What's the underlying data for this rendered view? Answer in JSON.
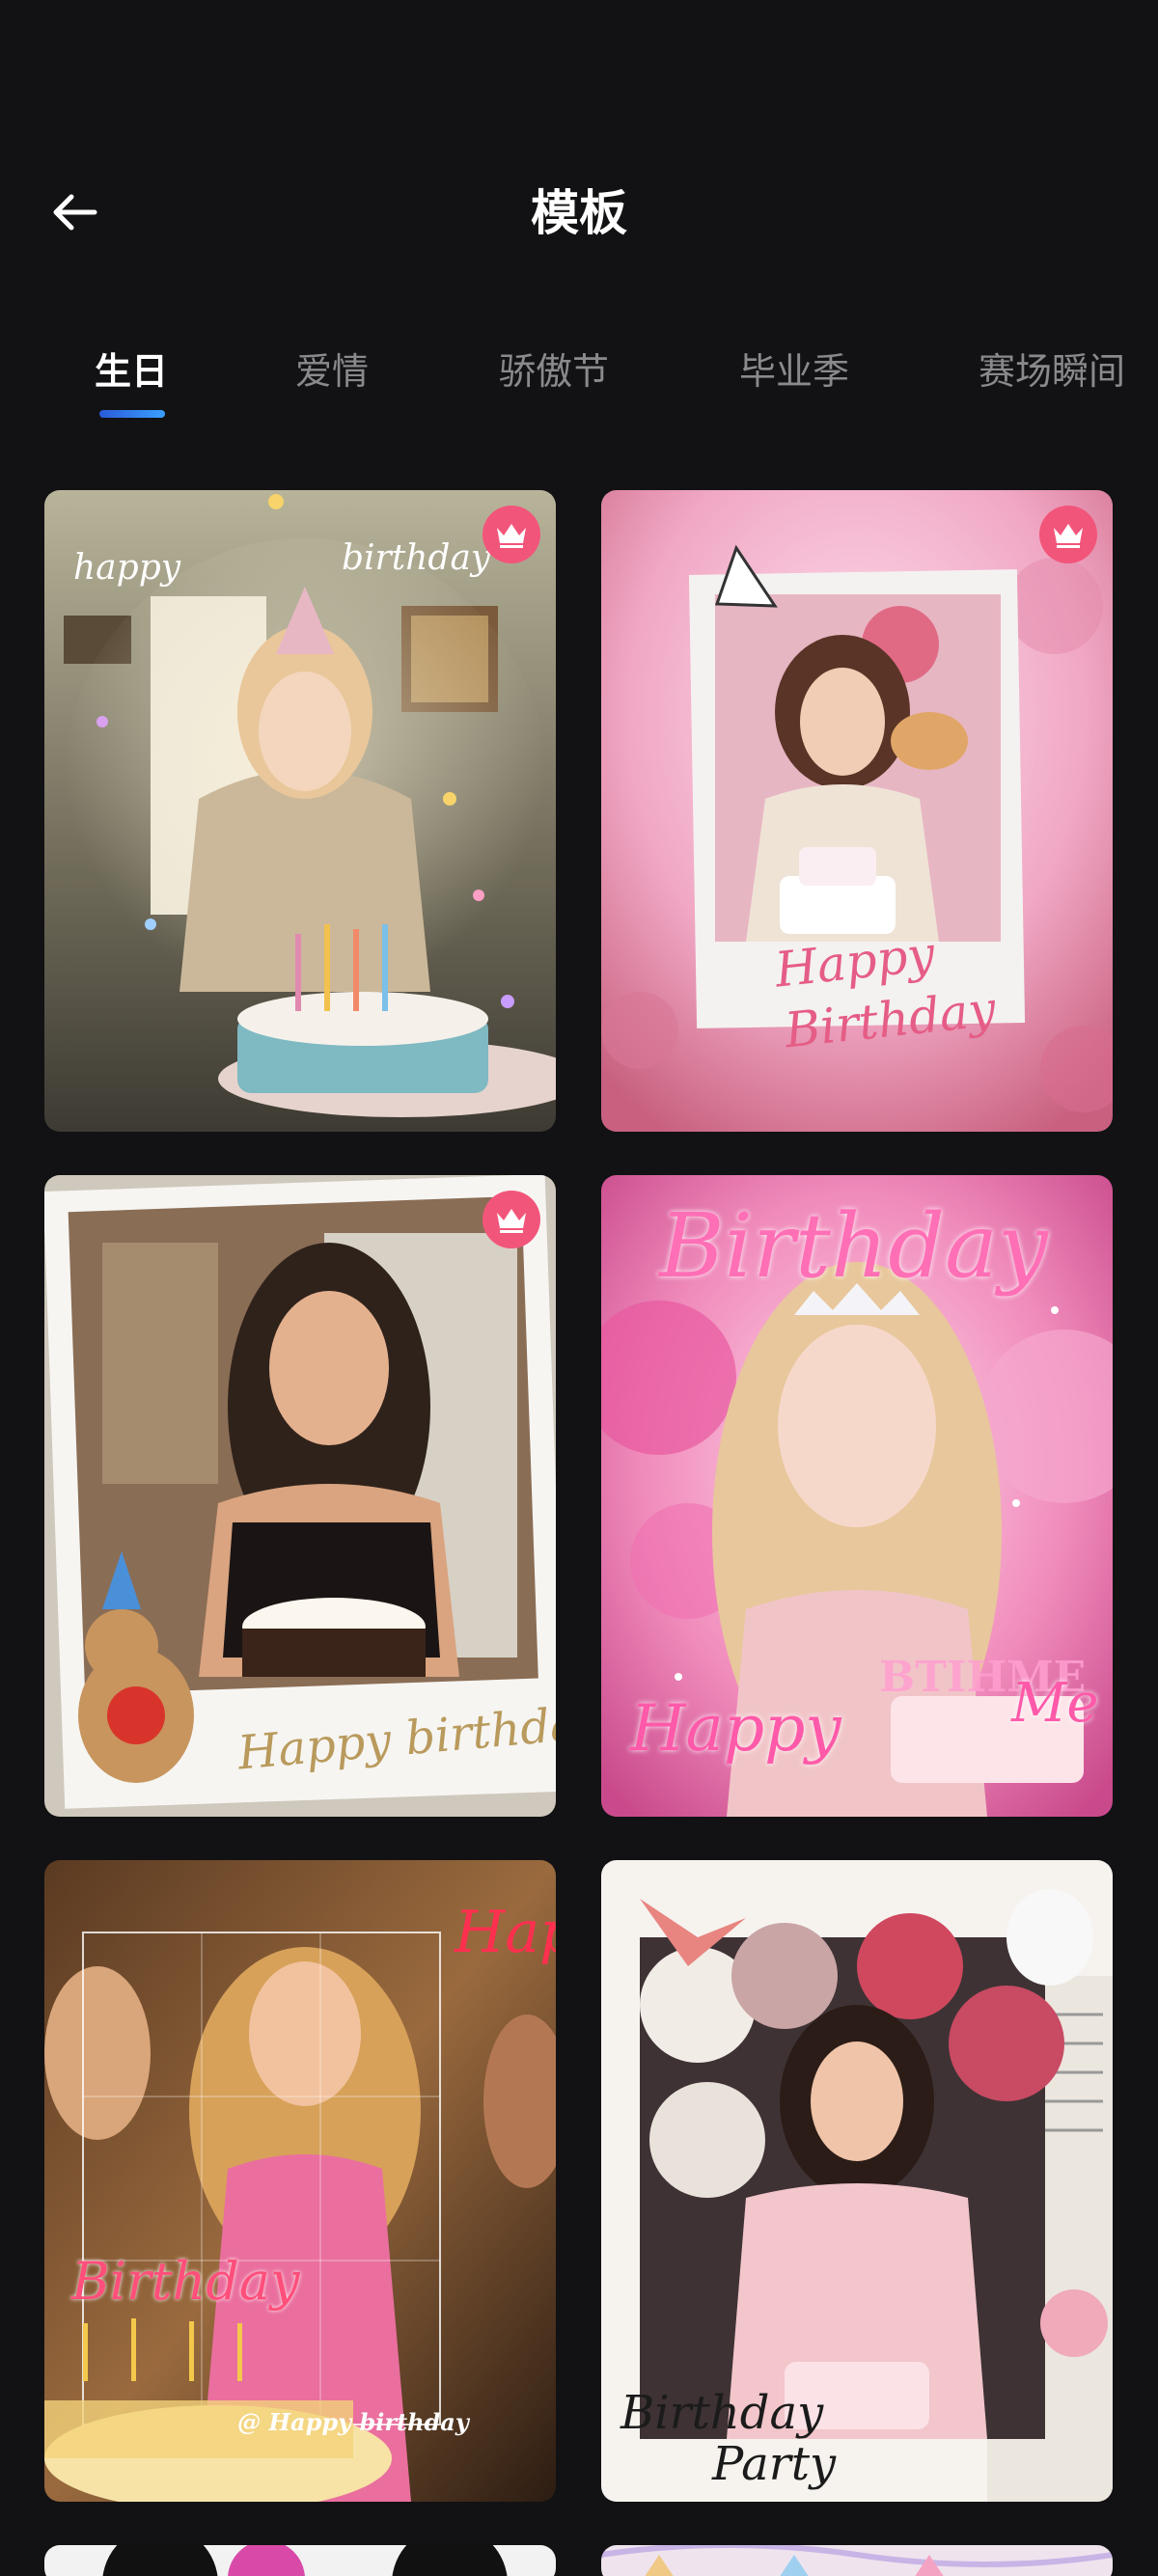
{
  "header": {
    "title": "模板",
    "back_icon": "arrow-left-icon"
  },
  "tabs": [
    {
      "label": "生日",
      "active": true
    },
    {
      "label": "爱情",
      "active": false
    },
    {
      "label": "骄傲节",
      "active": false
    },
    {
      "label": "毕业季",
      "active": false
    },
    {
      "label": "赛场瞬间",
      "active": false
    }
  ],
  "colors": {
    "background": "#121214",
    "vip_badge": "#f2557a",
    "tab_indicator": "#3aa0ff"
  },
  "templates": [
    {
      "vip": true,
      "overlay_texts": [
        "happy",
        "birthday"
      ]
    },
    {
      "vip": true,
      "overlay_texts": [
        "Happy",
        "Birthday"
      ]
    },
    {
      "vip": true,
      "overlay_texts": [
        "Happy birthday"
      ]
    },
    {
      "vip": false,
      "overlay_texts": [
        "Birthday",
        "Happy",
        "BTIHME",
        "Me"
      ]
    },
    {
      "vip": false,
      "overlay_texts": [
        "Happy",
        "Birthday",
        "@ Happy birthday"
      ]
    },
    {
      "vip": false,
      "overlay_texts": [
        "Birthday",
        "Party"
      ]
    }
  ]
}
